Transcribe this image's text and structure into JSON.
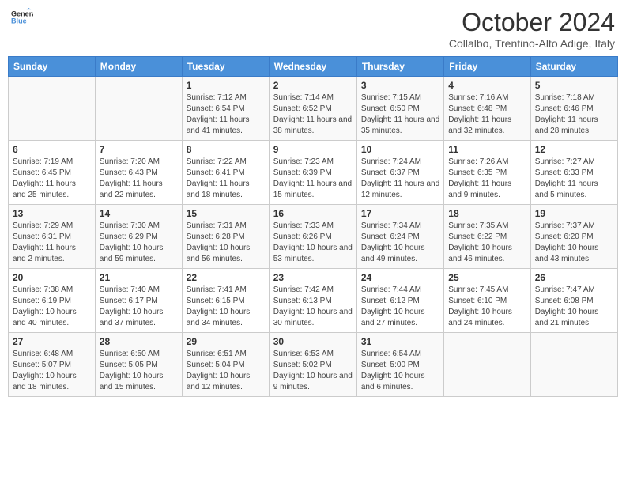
{
  "logo": {
    "line1": "General",
    "line2": "Blue"
  },
  "title": "October 2024",
  "subtitle": "Collalbo, Trentino-Alto Adige, Italy",
  "days": [
    "Sunday",
    "Monday",
    "Tuesday",
    "Wednesday",
    "Thursday",
    "Friday",
    "Saturday"
  ],
  "weeks": [
    [
      {
        "date": "",
        "sunrise": "",
        "sunset": "",
        "daylight": ""
      },
      {
        "date": "",
        "sunrise": "",
        "sunset": "",
        "daylight": ""
      },
      {
        "date": "1",
        "sunrise": "Sunrise: 7:12 AM",
        "sunset": "Sunset: 6:54 PM",
        "daylight": "Daylight: 11 hours and 41 minutes."
      },
      {
        "date": "2",
        "sunrise": "Sunrise: 7:14 AM",
        "sunset": "Sunset: 6:52 PM",
        "daylight": "Daylight: 11 hours and 38 minutes."
      },
      {
        "date": "3",
        "sunrise": "Sunrise: 7:15 AM",
        "sunset": "Sunset: 6:50 PM",
        "daylight": "Daylight: 11 hours and 35 minutes."
      },
      {
        "date": "4",
        "sunrise": "Sunrise: 7:16 AM",
        "sunset": "Sunset: 6:48 PM",
        "daylight": "Daylight: 11 hours and 32 minutes."
      },
      {
        "date": "5",
        "sunrise": "Sunrise: 7:18 AM",
        "sunset": "Sunset: 6:46 PM",
        "daylight": "Daylight: 11 hours and 28 minutes."
      }
    ],
    [
      {
        "date": "6",
        "sunrise": "Sunrise: 7:19 AM",
        "sunset": "Sunset: 6:45 PM",
        "daylight": "Daylight: 11 hours and 25 minutes."
      },
      {
        "date": "7",
        "sunrise": "Sunrise: 7:20 AM",
        "sunset": "Sunset: 6:43 PM",
        "daylight": "Daylight: 11 hours and 22 minutes."
      },
      {
        "date": "8",
        "sunrise": "Sunrise: 7:22 AM",
        "sunset": "Sunset: 6:41 PM",
        "daylight": "Daylight: 11 hours and 18 minutes."
      },
      {
        "date": "9",
        "sunrise": "Sunrise: 7:23 AM",
        "sunset": "Sunset: 6:39 PM",
        "daylight": "Daylight: 11 hours and 15 minutes."
      },
      {
        "date": "10",
        "sunrise": "Sunrise: 7:24 AM",
        "sunset": "Sunset: 6:37 PM",
        "daylight": "Daylight: 11 hours and 12 minutes."
      },
      {
        "date": "11",
        "sunrise": "Sunrise: 7:26 AM",
        "sunset": "Sunset: 6:35 PM",
        "daylight": "Daylight: 11 hours and 9 minutes."
      },
      {
        "date": "12",
        "sunrise": "Sunrise: 7:27 AM",
        "sunset": "Sunset: 6:33 PM",
        "daylight": "Daylight: 11 hours and 5 minutes."
      }
    ],
    [
      {
        "date": "13",
        "sunrise": "Sunrise: 7:29 AM",
        "sunset": "Sunset: 6:31 PM",
        "daylight": "Daylight: 11 hours and 2 minutes."
      },
      {
        "date": "14",
        "sunrise": "Sunrise: 7:30 AM",
        "sunset": "Sunset: 6:29 PM",
        "daylight": "Daylight: 10 hours and 59 minutes."
      },
      {
        "date": "15",
        "sunrise": "Sunrise: 7:31 AM",
        "sunset": "Sunset: 6:28 PM",
        "daylight": "Daylight: 10 hours and 56 minutes."
      },
      {
        "date": "16",
        "sunrise": "Sunrise: 7:33 AM",
        "sunset": "Sunset: 6:26 PM",
        "daylight": "Daylight: 10 hours and 53 minutes."
      },
      {
        "date": "17",
        "sunrise": "Sunrise: 7:34 AM",
        "sunset": "Sunset: 6:24 PM",
        "daylight": "Daylight: 10 hours and 49 minutes."
      },
      {
        "date": "18",
        "sunrise": "Sunrise: 7:35 AM",
        "sunset": "Sunset: 6:22 PM",
        "daylight": "Daylight: 10 hours and 46 minutes."
      },
      {
        "date": "19",
        "sunrise": "Sunrise: 7:37 AM",
        "sunset": "Sunset: 6:20 PM",
        "daylight": "Daylight: 10 hours and 43 minutes."
      }
    ],
    [
      {
        "date": "20",
        "sunrise": "Sunrise: 7:38 AM",
        "sunset": "Sunset: 6:19 PM",
        "daylight": "Daylight: 10 hours and 40 minutes."
      },
      {
        "date": "21",
        "sunrise": "Sunrise: 7:40 AM",
        "sunset": "Sunset: 6:17 PM",
        "daylight": "Daylight: 10 hours and 37 minutes."
      },
      {
        "date": "22",
        "sunrise": "Sunrise: 7:41 AM",
        "sunset": "Sunset: 6:15 PM",
        "daylight": "Daylight: 10 hours and 34 minutes."
      },
      {
        "date": "23",
        "sunrise": "Sunrise: 7:42 AM",
        "sunset": "Sunset: 6:13 PM",
        "daylight": "Daylight: 10 hours and 30 minutes."
      },
      {
        "date": "24",
        "sunrise": "Sunrise: 7:44 AM",
        "sunset": "Sunset: 6:12 PM",
        "daylight": "Daylight: 10 hours and 27 minutes."
      },
      {
        "date": "25",
        "sunrise": "Sunrise: 7:45 AM",
        "sunset": "Sunset: 6:10 PM",
        "daylight": "Daylight: 10 hours and 24 minutes."
      },
      {
        "date": "26",
        "sunrise": "Sunrise: 7:47 AM",
        "sunset": "Sunset: 6:08 PM",
        "daylight": "Daylight: 10 hours and 21 minutes."
      }
    ],
    [
      {
        "date": "27",
        "sunrise": "Sunrise: 6:48 AM",
        "sunset": "Sunset: 5:07 PM",
        "daylight": "Daylight: 10 hours and 18 minutes."
      },
      {
        "date": "28",
        "sunrise": "Sunrise: 6:50 AM",
        "sunset": "Sunset: 5:05 PM",
        "daylight": "Daylight: 10 hours and 15 minutes."
      },
      {
        "date": "29",
        "sunrise": "Sunrise: 6:51 AM",
        "sunset": "Sunset: 5:04 PM",
        "daylight": "Daylight: 10 hours and 12 minutes."
      },
      {
        "date": "30",
        "sunrise": "Sunrise: 6:53 AM",
        "sunset": "Sunset: 5:02 PM",
        "daylight": "Daylight: 10 hours and 9 minutes."
      },
      {
        "date": "31",
        "sunrise": "Sunrise: 6:54 AM",
        "sunset": "Sunset: 5:00 PM",
        "daylight": "Daylight: 10 hours and 6 minutes."
      },
      {
        "date": "",
        "sunrise": "",
        "sunset": "",
        "daylight": ""
      },
      {
        "date": "",
        "sunrise": "",
        "sunset": "",
        "daylight": ""
      }
    ]
  ]
}
